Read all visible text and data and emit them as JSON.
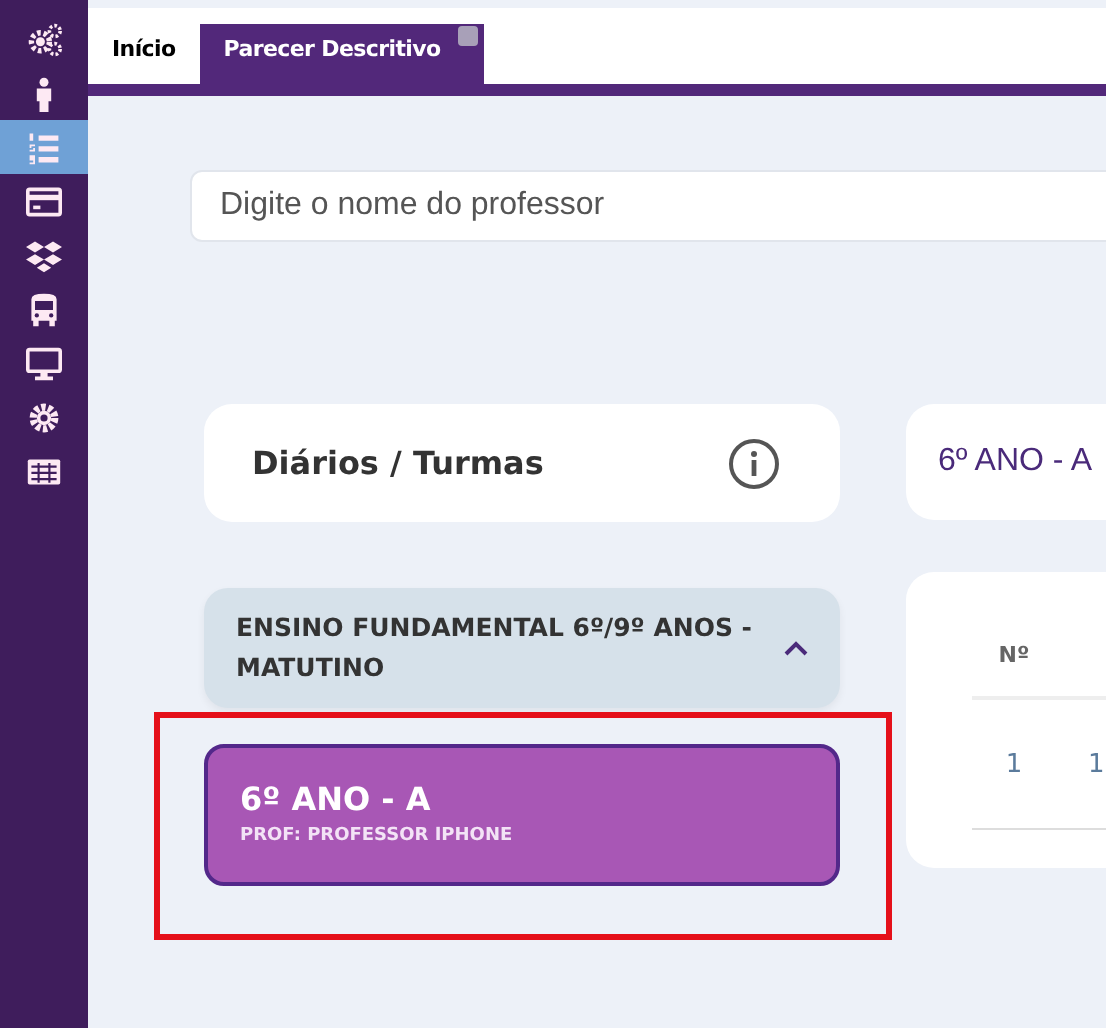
{
  "sidebar": {
    "items": [
      {
        "selected": false
      },
      {
        "selected": false
      },
      {
        "selected": true
      },
      {
        "selected": false
      },
      {
        "selected": false
      },
      {
        "selected": false
      },
      {
        "selected": false
      },
      {
        "selected": false
      },
      {
        "selected": false
      }
    ]
  },
  "tabs": [
    {
      "label": "Início",
      "selected": false,
      "closable": false
    },
    {
      "label": "Parecer Descritivo",
      "selected": true,
      "closable": true
    }
  ],
  "search": {
    "placeholder": "Digite o nome do professor"
  },
  "diarios_card": {
    "title": "Diários / Turmas"
  },
  "group": {
    "title": "ENSINO FUNDAMENTAL 6º/9º ANOS - MATUTINO",
    "expanded": true
  },
  "classes": [
    {
      "name": "6º ANO - A",
      "teacher": "PROF: PROFESSOR IPHONE",
      "selected": true
    }
  ],
  "class_header": {
    "title": "6º ANO - A"
  },
  "table": {
    "columns": [
      "Nº"
    ],
    "rows": [
      [
        "1",
        "1"
      ]
    ]
  }
}
